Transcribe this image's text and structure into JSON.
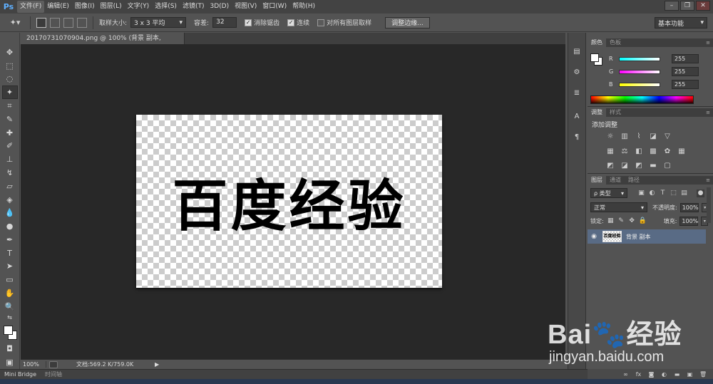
{
  "app": {
    "logo": "Ps"
  },
  "menu": [
    "文件(F)",
    "编辑(E)",
    "图像(I)",
    "图层(L)",
    "文字(Y)",
    "选择(S)",
    "滤镜(T)",
    "3D(D)",
    "视图(V)",
    "窗口(W)",
    "帮助(H)"
  ],
  "window_buttons": {
    "minimize": "–",
    "restore": "❐",
    "close": "✕"
  },
  "options": {
    "sample_size_label": "取样大小:",
    "sample_size_value": "3 x 3 平均",
    "tolerance_label": "容差:",
    "tolerance_value": "32",
    "antialias_label": "消除锯齿",
    "antialias_checked": true,
    "contiguous_label": "连续",
    "contiguous_checked": true,
    "all_layers_label": "对所有图层取样",
    "all_layers_checked": false,
    "refine_edge_label": "调整边缘...",
    "workspace_value": "基本功能"
  },
  "document": {
    "tab_title": "20170731070904.png @ 100% (背景 副本, RGB/8) *",
    "tab_close": "×",
    "canvas_text": "百度经验",
    "transparent": true
  },
  "status": {
    "zoom": "100%",
    "doc_size": "文档:569.2 K/759.0K",
    "arrow": "▶"
  },
  "bottom_tabs": [
    "Mini Bridge",
    "时间轴"
  ],
  "color_panel": {
    "tabs": [
      "颜色",
      "色板"
    ],
    "channels": [
      {
        "label": "R",
        "value": "255"
      },
      {
        "label": "G",
        "value": "255"
      },
      {
        "label": "B",
        "value": "255"
      }
    ],
    "fg_color": "#ffffff",
    "bg_color": "#ffffff"
  },
  "adjustments_panel": {
    "tabs": [
      "调整",
      "样式"
    ],
    "title": "添加调整"
  },
  "layers_panel": {
    "tabs": [
      "图层",
      "通道",
      "路径"
    ],
    "filter_type": "ρ 类型",
    "blend_mode": "正常",
    "opacity_label": "不透明度:",
    "opacity_value": "100%",
    "lock_label": "锁定:",
    "fill_label": "填充:",
    "fill_value": "100%",
    "layers": [
      {
        "name": "背景 副本",
        "visible": true,
        "selected": true,
        "thumb_text": "百度经验"
      }
    ]
  },
  "watermark": {
    "logo": "Bai🐾经验",
    "url": "jingyan.baidu.com"
  },
  "colors": {
    "accent_selection": "#596b85",
    "ps_blue": "#5fb0ff"
  }
}
